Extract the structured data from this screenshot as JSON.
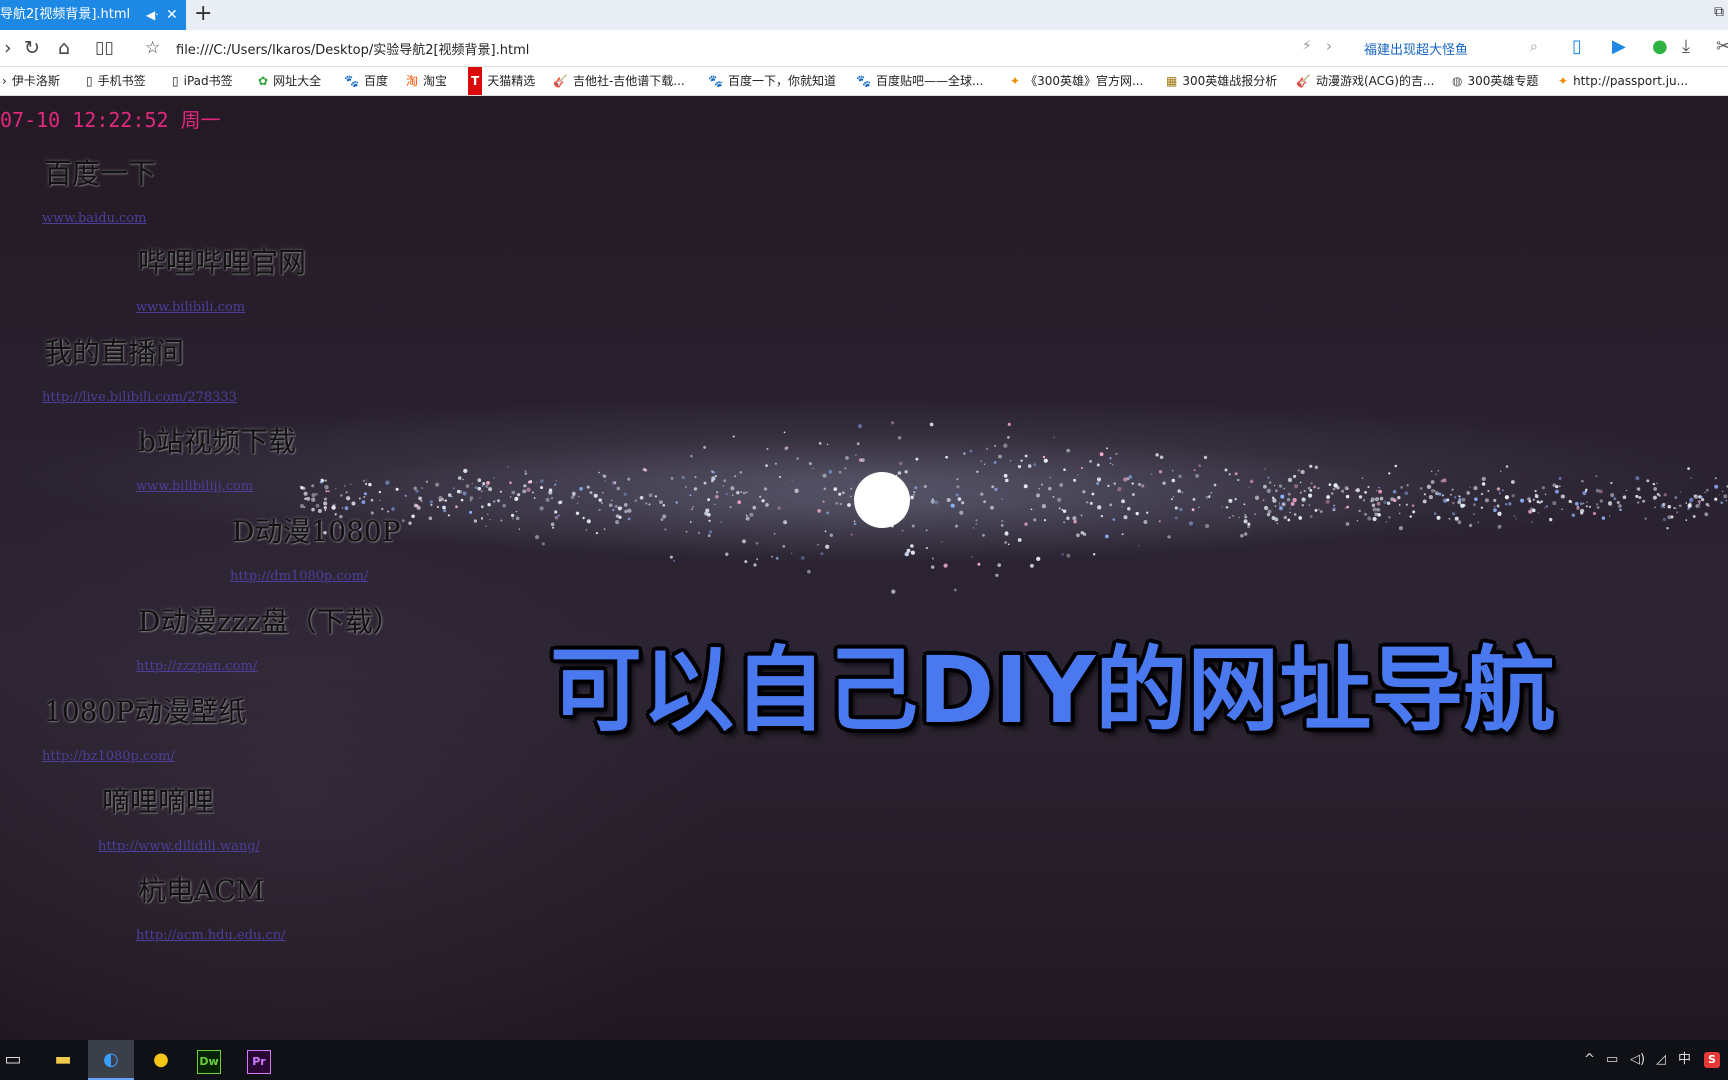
{
  "browser": {
    "tab_title": "导航2[视频背景].html",
    "tab_mute_icon": "speaker-icon",
    "tab_close": "✕",
    "new_tab": "+",
    "address": "file:///C:/Users/Ikaros/Desktop/实验导航2[视频背景].html",
    "search_value": "福建出现超大怪鱼"
  },
  "bookmarks": [
    {
      "label": "伊卡洛斯",
      "icon": "›"
    },
    {
      "label": "手机书签",
      "icon": "▯"
    },
    {
      "label": "iPad书签",
      "icon": "▯"
    },
    {
      "label": "网址大全",
      "icon": "✿"
    },
    {
      "label": "百度",
      "icon": "🐾"
    },
    {
      "label": "淘宝",
      "icon": "淘"
    },
    {
      "label": "天猫精选",
      "icon": "T"
    },
    {
      "label": "吉他社-吉他谱下载...",
      "icon": "🎸"
    },
    {
      "label": "百度一下，你就知道",
      "icon": "🐾"
    },
    {
      "label": "百度贴吧——全球...",
      "icon": "🐾"
    },
    {
      "label": "《300英雄》官方网...",
      "icon": "✦"
    },
    {
      "label": "300英雄战报分析",
      "icon": "▦"
    },
    {
      "label": "动漫游戏(ACG)的吉...",
      "icon": "🎸"
    },
    {
      "label": "300英雄专题",
      "icon": "◍"
    },
    {
      "label": "http://passport.ju...",
      "icon": "✦"
    }
  ],
  "page": {
    "datetime": "07-10 12:22:52 周一",
    "caption": "可以自己DIY的网址导航",
    "sites": [
      {
        "title": "百度一下",
        "url": "www.baidu.com"
      },
      {
        "title": "哔哩哔哩官网",
        "url": "www.bilibili.com"
      },
      {
        "title": "我的直播间",
        "url": "http://live.bilibili.com/278333"
      },
      {
        "title": "b站视频下载",
        "url": "www.bilibilijj.com"
      },
      {
        "title": "D动漫1080P",
        "url": "http://dm1080p.com/"
      },
      {
        "title": "D动漫zzz盘（下载）",
        "url": "http://zzzpan.com/"
      },
      {
        "title": "1080P动漫壁纸",
        "url": "http://bz1080p.com/"
      },
      {
        "title": "嘀哩嘀哩",
        "url": "http://www.dilidili.wang/"
      },
      {
        "title": "杭电ACM",
        "url": "http://acm.hdu.edu.cn/"
      }
    ]
  },
  "taskbar": {
    "apps": [
      "task-view-icon",
      "file-explorer-icon",
      "browser-icon",
      "media-player-icon",
      "dreamweaver-icon",
      "premiere-icon"
    ],
    "dw_label": "Dw",
    "pr_label": "Pr",
    "ime": "中",
    "caret": "^"
  },
  "colors": {
    "tab_active": "#1e88e5",
    "datetime": "#e0287e",
    "caption": "#4a78ee",
    "link": "#4a3f9a"
  }
}
